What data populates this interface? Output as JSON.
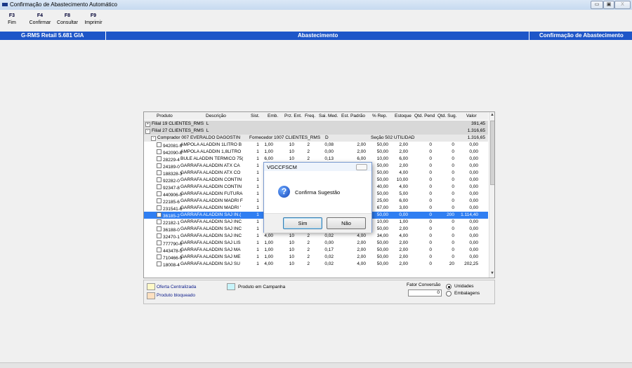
{
  "window": {
    "title": "Confirmação de Abastecimento Automático",
    "buttons": {
      "minimize": "▭",
      "maximize": "▣",
      "close": "X"
    }
  },
  "fkeys": [
    {
      "key": "F3",
      "label": "Fim"
    },
    {
      "key": "F4",
      "label": "Confirmar"
    },
    {
      "key": "F8",
      "label": "Consultar"
    },
    {
      "key": "F9",
      "label": "Imprimir"
    }
  ],
  "header_bar": {
    "left": "G-RMS Retail 5.681 GIA",
    "center": "Abastecimento",
    "right": "Confirmação de Abastecimento"
  },
  "columns": [
    "Produto",
    "Descrição",
    "Sist.",
    "Emb.",
    "Prz. Ent.",
    "Freq.",
    "Sai. Med.",
    "Est. Padrão",
    "% Rep.",
    "Estoque",
    "Qtd. Pend",
    "Qtd. Sug.",
    "Valor"
  ],
  "groups": [
    {
      "toggle": "+",
      "name": "Filial 19 CLIENTES_RMS",
      "flag": "L",
      "valor": "391,45"
    },
    {
      "toggle": "-",
      "name": "Filial 27 CLIENTES_RMS",
      "flag": "L",
      "valor": "1.316,65"
    }
  ],
  "subgroup": {
    "toggle": "-",
    "comprador": "Comprador 007 EVERALDO DAGOSTIN",
    "fornecedor": "Fornecedor 1007 CLIENTES_RMS",
    "flag": "D",
    "secao": "Seção 502 UTILIDAD",
    "valor": "1.316,65"
  },
  "rows": [
    {
      "produto": "942081-9",
      "descricao": "AMPOLA ALADDIN 1LITRO B",
      "sist": "1",
      "emb": "1,00",
      "prz": "10",
      "freq": "2",
      "sai": "0,08",
      "est": "2,00",
      "rep": "50,00",
      "estoque": "2,00",
      "pend": "0",
      "sug": "0",
      "valor": "0,00"
    },
    {
      "produto": "942090-8",
      "descricao": "AMPOLA ALADDIN 1,8LITRO",
      "sist": "1",
      "emb": "1,00",
      "prz": "10",
      "freq": "2",
      "sai": "0,00",
      "est": "2,00",
      "rep": "50,00",
      "estoque": "2,00",
      "pend": "0",
      "sug": "0",
      "valor": "0,00"
    },
    {
      "produto": "28229-4",
      "descricao": "BULE ALADDIN TERMICO 75(",
      "sist": "1",
      "emb": "6,00",
      "prz": "10",
      "freq": "2",
      "sai": "0,13",
      "est": "6,00",
      "rep": "10,00",
      "estoque": "6,00",
      "pend": "0",
      "sug": "0",
      "valor": "0,00"
    },
    {
      "produto": "24189-0",
      "descricao": "GARRAFA ALADDIN ATX CA",
      "sist": "1",
      "emb": "",
      "prz": "",
      "freq": "",
      "sai": "",
      "est": "",
      "rep": "50,00",
      "estoque": "2,00",
      "pend": "0",
      "sug": "0",
      "valor": "0,00"
    },
    {
      "produto": "188328-3",
      "descricao": "GARRAFA ALADDIN ATX CO",
      "sist": "1",
      "emb": "",
      "prz": "",
      "freq": "",
      "sai": "",
      "est": "",
      "rep": "50,00",
      "estoque": "4,00",
      "pend": "0",
      "sug": "0",
      "valor": "0,00"
    },
    {
      "produto": "92282-0",
      "descricao": "GARRAFA ALADDIN CONTIN",
      "sist": "1",
      "emb": "",
      "prz": "",
      "freq": "",
      "sai": "",
      "est": "",
      "rep": "50,00",
      "estoque": "10,00",
      "pend": "0",
      "sug": "0",
      "valor": "0,00"
    },
    {
      "produto": "92347-8",
      "descricao": "GARRAFA ALADDIN CONTIN",
      "sist": "1",
      "emb": "",
      "prz": "",
      "freq": "",
      "sai": "",
      "est": "",
      "rep": "40,00",
      "estoque": "4,00",
      "pend": "0",
      "sug": "0",
      "valor": "0,00"
    },
    {
      "produto": "440906-0",
      "descricao": "GARRAFA ALADDIN FUTURA",
      "sist": "1",
      "emb": "",
      "prz": "",
      "freq": "",
      "sai": "",
      "est": "",
      "rep": "50,00",
      "estoque": "5,00",
      "pend": "0",
      "sug": "0",
      "valor": "0,00"
    },
    {
      "produto": "22185-6",
      "descricao": "GARRAFA ALADDIN MADRI F",
      "sist": "1",
      "emb": "",
      "prz": "",
      "freq": "",
      "sai": "",
      "est": "",
      "rep": "25,00",
      "estoque": "6,00",
      "pend": "0",
      "sug": "0",
      "valor": "0,00"
    },
    {
      "produto": "231541-6",
      "descricao": "GARRAFA ALADDIN MADRI '",
      "sist": "1",
      "emb": "",
      "prz": "",
      "freq": "",
      "sai": "",
      "est": "",
      "rep": "67,00",
      "estoque": "3,00",
      "pend": "0",
      "sug": "0",
      "valor": "0,00"
    },
    {
      "produto": "36185-2",
      "descricao": "GARRAFA ALADDIN SAJ IN.(",
      "sist": "1",
      "emb": "",
      "prz": "",
      "freq": "",
      "sai": "",
      "est": "",
      "rep": "50,00",
      "estoque": "0,00",
      "pend": "0",
      "sug": "200",
      "valor": "1.114,40"
    },
    {
      "produto": "22182-1",
      "descricao": "GARRAFA ALADDIN SAJ INC",
      "sist": "1",
      "emb": "",
      "prz": "",
      "freq": "",
      "sai": "",
      "est": "",
      "rep": "10,00",
      "estoque": "1,00",
      "pend": "0",
      "sug": "0",
      "valor": "0,00"
    },
    {
      "produto": "36188-0",
      "descricao": "GARRAFA ALADDIN SAJ INC",
      "sist": "1",
      "emb": "",
      "prz": "",
      "freq": "",
      "sai": "",
      "est": "",
      "rep": "50,00",
      "estoque": "2,00",
      "pend": "0",
      "sug": "0",
      "valor": "0,00"
    },
    {
      "produto": "32470-1",
      "descricao": "GARRAFA ALADDIN SAJ INC",
      "sist": "1",
      "emb": "4,00",
      "prz": "10",
      "freq": "2",
      "sai": "0,02",
      "est": "4,00",
      "rep": "34,00",
      "estoque": "4,00",
      "pend": "0",
      "sug": "0",
      "valor": "0,00"
    },
    {
      "produto": "777790-6",
      "descricao": "GARRAFA ALADDIN SAJ LIS",
      "sist": "1",
      "emb": "1,00",
      "prz": "10",
      "freq": "2",
      "sai": "0,00",
      "est": "2,00",
      "rep": "50,00",
      "estoque": "2,00",
      "pend": "0",
      "sug": "0",
      "valor": "0,00"
    },
    {
      "produto": "443478-5",
      "descricao": "GARRAFA ALADDIN SAJ MA",
      "sist": "1",
      "emb": "1,00",
      "prz": "10",
      "freq": "2",
      "sai": "0,17",
      "est": "2,00",
      "rep": "50,00",
      "estoque": "2,00",
      "pend": "0",
      "sug": "0",
      "valor": "0,00"
    },
    {
      "produto": "710466-9",
      "descricao": "GARRAFA ALADDIN SAJ ME",
      "sist": "1",
      "emb": "1,00",
      "prz": "10",
      "freq": "2",
      "sai": "0,02",
      "est": "2,00",
      "rep": "50,00",
      "estoque": "2,00",
      "pend": "0",
      "sug": "0",
      "valor": "0,00"
    },
    {
      "produto": "18008-4",
      "descricao": "GARRAFA ALADDIN SAJ SU",
      "sist": "1",
      "emb": "4,00",
      "prz": "10",
      "freq": "2",
      "sai": "0,02",
      "est": "4,00",
      "rep": "50,00",
      "estoque": "2,00",
      "pend": "0",
      "sug": "20",
      "valor": "202,25"
    }
  ],
  "selected_row": 10,
  "legend": {
    "oferta": "Oferta Centralizada",
    "campanha": "Produto em Campanha",
    "bloqueado": "Produto bloqueado"
  },
  "colors": {
    "oferta": "#fff9c8",
    "campanha": "#c8f4fa",
    "bloqueado": "#fde0c0",
    "selected": "#2f7ef2",
    "header_bar": "#1e56c8"
  },
  "fator": {
    "label": "Fator Conversão",
    "value": "0",
    "opt_unidades": "Unidades",
    "opt_embalagens": "Embalagens",
    "selected": "Unidades"
  },
  "dialog": {
    "title": "VGCCFSCM",
    "message": "Confirma Sugestão",
    "yes": "Sim",
    "no": "Não",
    "icon": "question-icon"
  }
}
